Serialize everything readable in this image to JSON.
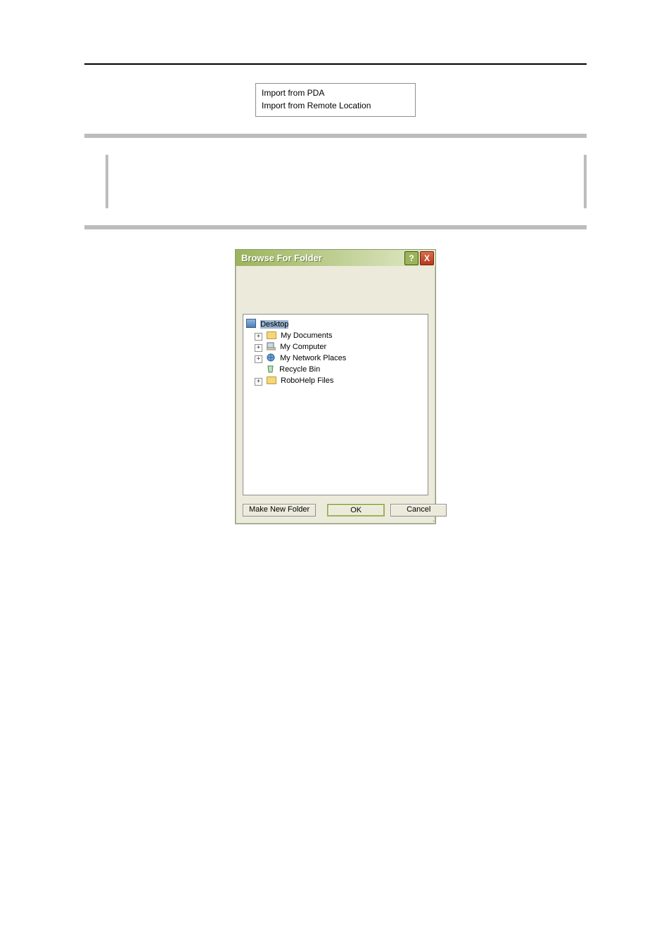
{
  "dropdown": {
    "opt1": "Import from PDA",
    "opt2": "Import from Remote Location"
  },
  "dialog": {
    "title": "Browse For Folder",
    "tree": {
      "root": "Desktop",
      "items": [
        "My Documents",
        "My Computer",
        "My Network Places",
        "Recycle Bin",
        "RoboHelp Files"
      ]
    },
    "buttons": {
      "new_folder": "Make New Folder",
      "ok": "OK",
      "cancel": "Cancel"
    },
    "help_glyph": "?",
    "close_glyph": "X"
  }
}
